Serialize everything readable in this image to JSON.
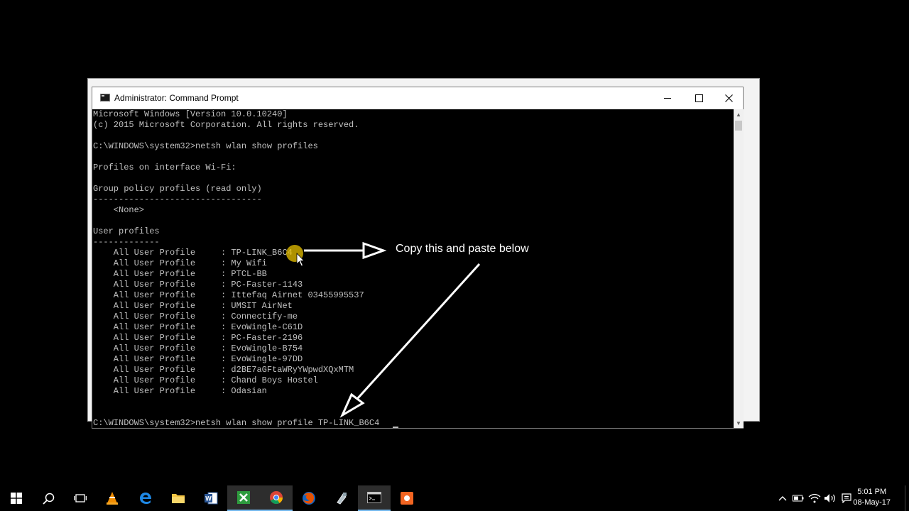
{
  "window": {
    "title": "Administrator: Command Prompt"
  },
  "console": {
    "lines": [
      "Microsoft Windows [Version 10.0.10240]",
      "(c) 2015 Microsoft Corporation. All rights reserved.",
      "",
      "C:\\WINDOWS\\system32>netsh wlan show profiles",
      "",
      "Profiles on interface Wi-Fi:",
      "",
      "Group policy profiles (read only)",
      "---------------------------------",
      "    <None>",
      "",
      "User profiles",
      "-------------",
      "    All User Profile     : TP-LINK_B6C4",
      "    All User Profile     : My Wifi",
      "    All User Profile     : PTCL-BB",
      "    All User Profile     : PC-Faster-1143",
      "    All User Profile     : Ittefaq Airnet 03455995537",
      "    All User Profile     : UMSIT AirNet",
      "    All User Profile     : Connectify-me",
      "    All User Profile     : EvoWingle-C61D",
      "    All User Profile     : PC-Faster-2196",
      "    All User Profile     : EvoWingle-B754",
      "    All User Profile     : EvoWingle-97DD",
      "    All User Profile     : d2BE7aGFtaWRyYWpwdXQxMTM",
      "    All User Profile     : Chand Boys Hostel",
      "    All User Profile     : Odasian",
      "",
      "",
      "C:\\WINDOWS\\system32>netsh wlan show profile TP-LINK_B6C4"
    ]
  },
  "annotation": {
    "text": "Copy this and paste below"
  },
  "clock": {
    "time": "5:01 PM",
    "date": "08-May-17"
  },
  "colors": {
    "console_bg": "#000000",
    "console_fg": "#c0c0c0",
    "taskbar_accent": "#76b9ed"
  }
}
